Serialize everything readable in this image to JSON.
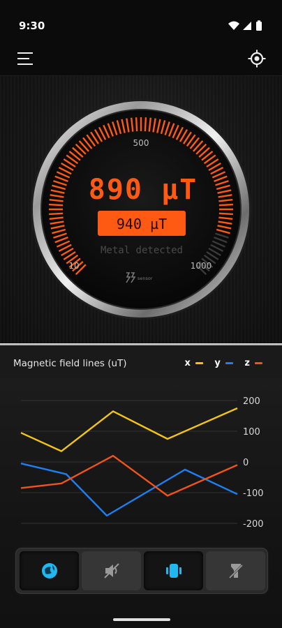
{
  "status": {
    "time": "9:30"
  },
  "gauge": {
    "reading": "890 µT",
    "sub_reading": "940 µT",
    "status_text": "Metal detected",
    "scale_min": "10",
    "scale_mid": "500",
    "scale_max": "1000",
    "level_fraction": 0.89,
    "brand": "sensor",
    "accent_color": "#ff5a14"
  },
  "chart_data": {
    "type": "line",
    "title": "Magnetic field lines (uT)",
    "ylim": [
      -200,
      200
    ],
    "yticks": [
      "200",
      "100",
      "0",
      "-100",
      "-200"
    ],
    "x": [
      0,
      1,
      2,
      3,
      4,
      5,
      6
    ],
    "series": [
      {
        "name": "x",
        "color": "#f2c418",
        "values": [
          95,
          35,
          165,
          75,
          175
        ]
      },
      {
        "name": "y",
        "color": "#1e7ff0",
        "values": [
          -5,
          -40,
          -175,
          -25,
          -105
        ]
      },
      {
        "name": "z",
        "color": "#f0541a",
        "values": [
          -85,
          -70,
          20,
          -110,
          -10
        ]
      }
    ]
  },
  "toolbar": {
    "items": [
      {
        "icon": "magnet-sphere-icon",
        "active": true
      },
      {
        "icon": "sound-off-icon",
        "active": false
      },
      {
        "icon": "vibrate-icon",
        "active": true
      },
      {
        "icon": "flashlight-off-icon",
        "active": false
      }
    ]
  }
}
